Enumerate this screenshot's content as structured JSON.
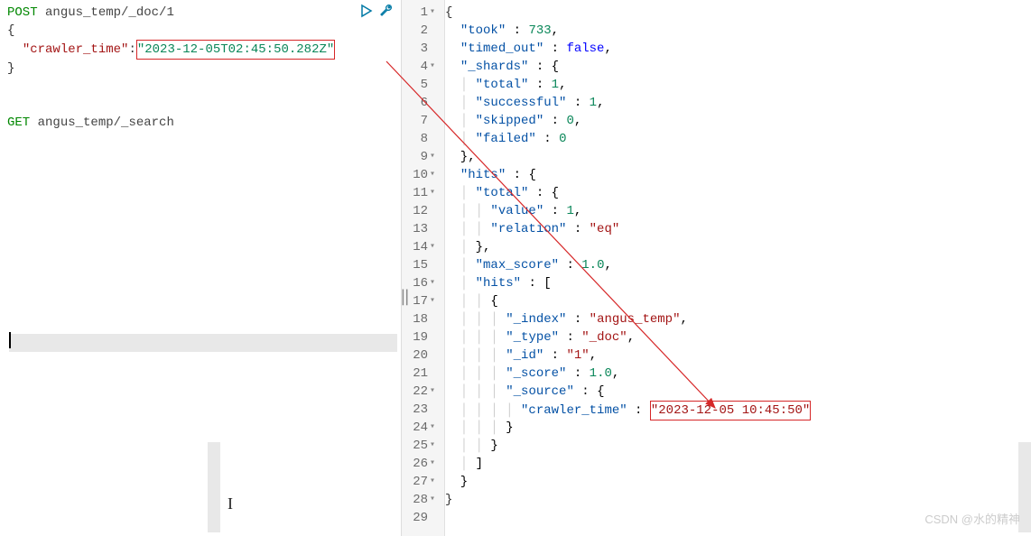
{
  "left": {
    "request1": {
      "method": "POST",
      "path": "angus_temp/_doc/1",
      "body_open": "{",
      "body_key": "\"crawler_time\"",
      "body_colon": ":",
      "body_value": "\"2023-12-05T02:45:50.282Z\"",
      "body_close": "}"
    },
    "request2": {
      "method": "GET",
      "path": "angus_temp/_search"
    }
  },
  "right": {
    "lines": [
      {
        "num": "1",
        "fold": "▾",
        "text": [
          {
            "t": "{",
            "c": "rbrace"
          }
        ]
      },
      {
        "num": "2",
        "fold": "",
        "text": [
          {
            "t": "  ",
            "c": ""
          },
          {
            "t": "\"took\"",
            "c": "rkey"
          },
          {
            "t": " : ",
            "c": ""
          },
          {
            "t": "733",
            "c": "rnum"
          },
          {
            "t": ",",
            "c": ""
          }
        ]
      },
      {
        "num": "3",
        "fold": "",
        "text": [
          {
            "t": "  ",
            "c": ""
          },
          {
            "t": "\"timed_out\"",
            "c": "rkey"
          },
          {
            "t": " : ",
            "c": ""
          },
          {
            "t": "false",
            "c": "rbool"
          },
          {
            "t": ",",
            "c": ""
          }
        ]
      },
      {
        "num": "4",
        "fold": "▾",
        "text": [
          {
            "t": "  ",
            "c": ""
          },
          {
            "t": "\"_shards\"",
            "c": "rkey"
          },
          {
            "t": " : {",
            "c": ""
          }
        ]
      },
      {
        "num": "5",
        "fold": "",
        "text": [
          {
            "t": "  ",
            "c": ""
          },
          {
            "t": "│ ",
            "c": "guide"
          },
          {
            "t": "\"total\"",
            "c": "rkey"
          },
          {
            "t": " : ",
            "c": ""
          },
          {
            "t": "1",
            "c": "rnum"
          },
          {
            "t": ",",
            "c": ""
          }
        ]
      },
      {
        "num": "6",
        "fold": "",
        "text": [
          {
            "t": "  ",
            "c": ""
          },
          {
            "t": "│ ",
            "c": "guide"
          },
          {
            "t": "\"successful\"",
            "c": "rkey"
          },
          {
            "t": " : ",
            "c": ""
          },
          {
            "t": "1",
            "c": "rnum"
          },
          {
            "t": ",",
            "c": ""
          }
        ]
      },
      {
        "num": "7",
        "fold": "",
        "text": [
          {
            "t": "  ",
            "c": ""
          },
          {
            "t": "│ ",
            "c": "guide"
          },
          {
            "t": "\"skipped\"",
            "c": "rkey"
          },
          {
            "t": " : ",
            "c": ""
          },
          {
            "t": "0",
            "c": "rnum"
          },
          {
            "t": ",",
            "c": ""
          }
        ]
      },
      {
        "num": "8",
        "fold": "",
        "text": [
          {
            "t": "  ",
            "c": ""
          },
          {
            "t": "│ ",
            "c": "guide"
          },
          {
            "t": "\"failed\"",
            "c": "rkey"
          },
          {
            "t": " : ",
            "c": ""
          },
          {
            "t": "0",
            "c": "rnum"
          }
        ]
      },
      {
        "num": "9",
        "fold": "▾",
        "text": [
          {
            "t": "  },",
            "c": ""
          }
        ]
      },
      {
        "num": "10",
        "fold": "▾",
        "text": [
          {
            "t": "  ",
            "c": ""
          },
          {
            "t": "\"hits\"",
            "c": "rkey"
          },
          {
            "t": " : {",
            "c": ""
          }
        ]
      },
      {
        "num": "11",
        "fold": "▾",
        "text": [
          {
            "t": "  ",
            "c": ""
          },
          {
            "t": "│ ",
            "c": "guide"
          },
          {
            "t": "\"total\"",
            "c": "rkey"
          },
          {
            "t": " : {",
            "c": ""
          }
        ]
      },
      {
        "num": "12",
        "fold": "",
        "text": [
          {
            "t": "  ",
            "c": ""
          },
          {
            "t": "│ │ ",
            "c": "guide"
          },
          {
            "t": "\"value\"",
            "c": "rkey"
          },
          {
            "t": " : ",
            "c": ""
          },
          {
            "t": "1",
            "c": "rnum"
          },
          {
            "t": ",",
            "c": ""
          }
        ]
      },
      {
        "num": "13",
        "fold": "",
        "text": [
          {
            "t": "  ",
            "c": ""
          },
          {
            "t": "│ │ ",
            "c": "guide"
          },
          {
            "t": "\"relation\"",
            "c": "rkey"
          },
          {
            "t": " : ",
            "c": ""
          },
          {
            "t": "\"eq\"",
            "c": "rstr"
          }
        ]
      },
      {
        "num": "14",
        "fold": "▾",
        "text": [
          {
            "t": "  ",
            "c": ""
          },
          {
            "t": "│ ",
            "c": "guide"
          },
          {
            "t": "},",
            "c": ""
          }
        ]
      },
      {
        "num": "15",
        "fold": "",
        "text": [
          {
            "t": "  ",
            "c": ""
          },
          {
            "t": "│ ",
            "c": "guide"
          },
          {
            "t": "\"max_score\"",
            "c": "rkey"
          },
          {
            "t": " : ",
            "c": ""
          },
          {
            "t": "1.0",
            "c": "rnum"
          },
          {
            "t": ",",
            "c": ""
          }
        ]
      },
      {
        "num": "16",
        "fold": "▾",
        "text": [
          {
            "t": "  ",
            "c": ""
          },
          {
            "t": "│ ",
            "c": "guide"
          },
          {
            "t": "\"hits\"",
            "c": "rkey"
          },
          {
            "t": " : [",
            "c": ""
          }
        ]
      },
      {
        "num": "17",
        "fold": "▾",
        "text": [
          {
            "t": "  ",
            "c": ""
          },
          {
            "t": "│ │ ",
            "c": "guide"
          },
          {
            "t": "{",
            "c": ""
          }
        ]
      },
      {
        "num": "18",
        "fold": "",
        "text": [
          {
            "t": "  ",
            "c": ""
          },
          {
            "t": "│ │ │ ",
            "c": "guide"
          },
          {
            "t": "\"_index\"",
            "c": "rkey"
          },
          {
            "t": " : ",
            "c": ""
          },
          {
            "t": "\"angus_temp\"",
            "c": "rstr"
          },
          {
            "t": ",",
            "c": ""
          }
        ]
      },
      {
        "num": "19",
        "fold": "",
        "text": [
          {
            "t": "  ",
            "c": ""
          },
          {
            "t": "│ │ │ ",
            "c": "guide"
          },
          {
            "t": "\"_type\"",
            "c": "rkey"
          },
          {
            "t": " : ",
            "c": ""
          },
          {
            "t": "\"_doc\"",
            "c": "rstr"
          },
          {
            "t": ",",
            "c": ""
          }
        ]
      },
      {
        "num": "20",
        "fold": "",
        "text": [
          {
            "t": "  ",
            "c": ""
          },
          {
            "t": "│ │ │ ",
            "c": "guide"
          },
          {
            "t": "\"_id\"",
            "c": "rkey"
          },
          {
            "t": " : ",
            "c": ""
          },
          {
            "t": "\"1\"",
            "c": "rstr"
          },
          {
            "t": ",",
            "c": ""
          }
        ]
      },
      {
        "num": "21",
        "fold": "",
        "text": [
          {
            "t": "  ",
            "c": ""
          },
          {
            "t": "│ │ │ ",
            "c": "guide"
          },
          {
            "t": "\"_score\"",
            "c": "rkey"
          },
          {
            "t": " : ",
            "c": ""
          },
          {
            "t": "1.0",
            "c": "rnum"
          },
          {
            "t": ",",
            "c": ""
          }
        ]
      },
      {
        "num": "22",
        "fold": "▾",
        "text": [
          {
            "t": "  ",
            "c": ""
          },
          {
            "t": "│ │ │ ",
            "c": "guide"
          },
          {
            "t": "\"_source\"",
            "c": "rkey"
          },
          {
            "t": " : {",
            "c": ""
          }
        ]
      },
      {
        "num": "23",
        "fold": "",
        "text": [
          {
            "t": "  ",
            "c": ""
          },
          {
            "t": "│ │ │ │ ",
            "c": "guide"
          },
          {
            "t": "\"crawler_time\"",
            "c": "rkey"
          },
          {
            "t": " : ",
            "c": ""
          },
          {
            "t": "HIGHLIGHT",
            "c": "hl"
          }
        ]
      },
      {
        "num": "24",
        "fold": "▾",
        "text": [
          {
            "t": "  ",
            "c": ""
          },
          {
            "t": "│ │ │ ",
            "c": "guide"
          },
          {
            "t": "}",
            "c": ""
          }
        ]
      },
      {
        "num": "25",
        "fold": "▾",
        "text": [
          {
            "t": "  ",
            "c": ""
          },
          {
            "t": "│ │ ",
            "c": "guide"
          },
          {
            "t": "}",
            "c": ""
          }
        ]
      },
      {
        "num": "26",
        "fold": "▾",
        "text": [
          {
            "t": "  ",
            "c": ""
          },
          {
            "t": "│ ",
            "c": "guide"
          },
          {
            "t": "]",
            "c": ""
          }
        ]
      },
      {
        "num": "27",
        "fold": "▾",
        "text": [
          {
            "t": "  }",
            "c": ""
          }
        ]
      },
      {
        "num": "28",
        "fold": "▾",
        "text": [
          {
            "t": "}",
            "c": "rbrace"
          }
        ]
      },
      {
        "num": "29",
        "fold": "",
        "text": []
      }
    ],
    "highlighted_value": "\"2023-12-05 10:45:50\""
  },
  "watermark": "CSDN @水的精神"
}
